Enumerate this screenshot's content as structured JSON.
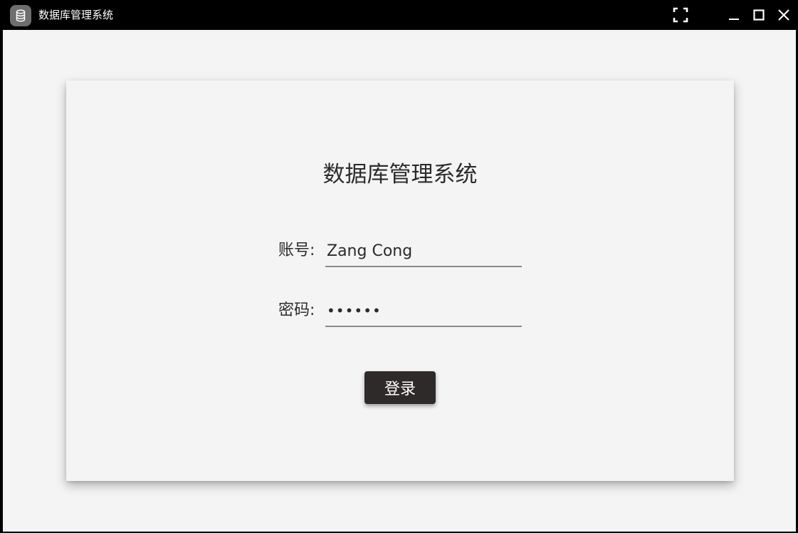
{
  "window": {
    "title": "数据库管理系统",
    "app_icon": "database-icon",
    "controls": [
      "fullscreen-icon",
      "minimize-icon",
      "maximize-icon",
      "close-icon"
    ]
  },
  "login": {
    "title": "数据库管理系统",
    "account_label": "账号:",
    "account_value": "Zang Cong",
    "password_label": "密码:",
    "password_value": "••••••",
    "submit_label": "登录"
  },
  "colors": {
    "titlebar": "#000000",
    "background": "#f4f4f4",
    "button": "#2f2a2a",
    "text": "#2b2b2b"
  }
}
